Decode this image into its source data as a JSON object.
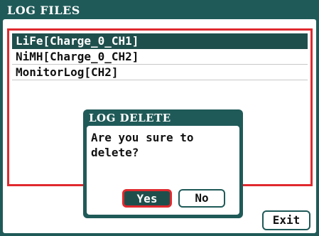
{
  "window": {
    "title": "LOG FILES"
  },
  "log_list": {
    "items": [
      {
        "label": "LiFe[Charge_0_CH1]",
        "selected": true
      },
      {
        "label": "NiMH[Charge_0_CH2]",
        "selected": false
      },
      {
        "label": "MonitorLog[CH2]",
        "selected": false
      }
    ]
  },
  "dialog": {
    "title": "LOG DELETE",
    "message": "Are you sure to\ndelete?",
    "yes_label": "Yes",
    "no_label": "No"
  },
  "footer": {
    "exit_label": "Exit"
  },
  "colors": {
    "header_bg": "#1f5a58",
    "selection_bg": "#1f4f4c",
    "focus_border": "#e0292e"
  }
}
